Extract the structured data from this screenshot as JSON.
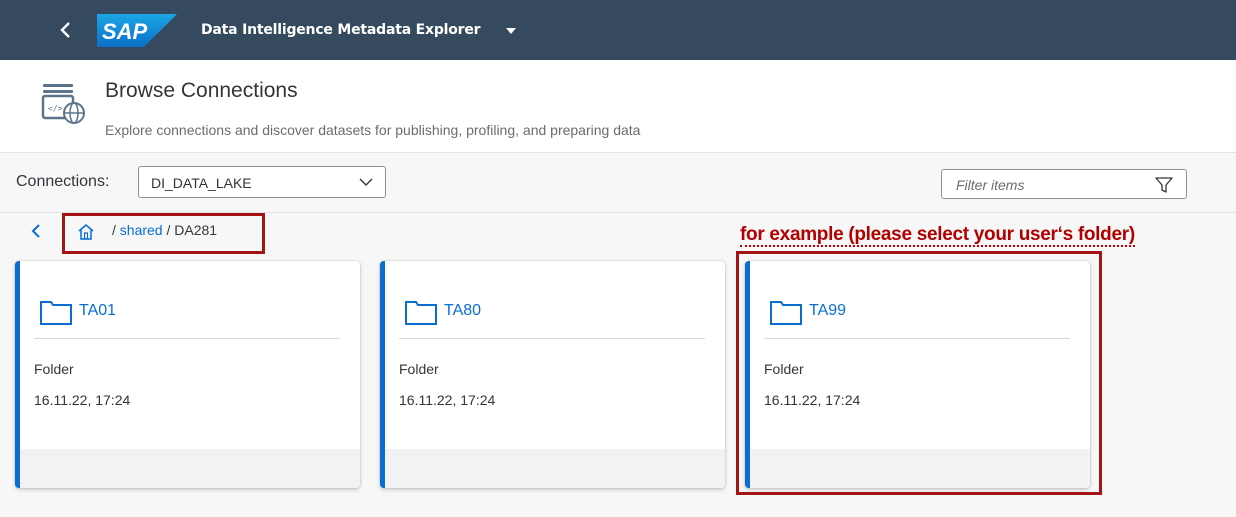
{
  "shell": {
    "logo_text": "SAP",
    "app_title": "Data Intelligence Metadata Explorer",
    "brand_color": "#354a5f"
  },
  "page": {
    "title": "Browse Connections",
    "subtitle": "Explore connections and discover datasets for publishing, profiling, and preparing data"
  },
  "toolbar": {
    "connections_label": "Connections:",
    "connection_selected": "DI_DATA_LAKE",
    "filter_placeholder": "Filter items"
  },
  "breadcrumb": {
    "separator1": "/",
    "link": "shared",
    "separator2": "/",
    "current": "DA281"
  },
  "annotation": {
    "note": "for example (please select your user‘s folder)"
  },
  "cards": [
    {
      "title": "TA01",
      "type": "Folder",
      "date": "16.11.22, 17:24"
    },
    {
      "title": "TA80",
      "type": "Folder",
      "date": "16.11.22, 17:24"
    },
    {
      "title": "TA99",
      "type": "Folder",
      "date": "16.11.22, 17:24"
    }
  ],
  "colors": {
    "accent": "#0a6ed1",
    "annotation_red": "#a31515"
  }
}
